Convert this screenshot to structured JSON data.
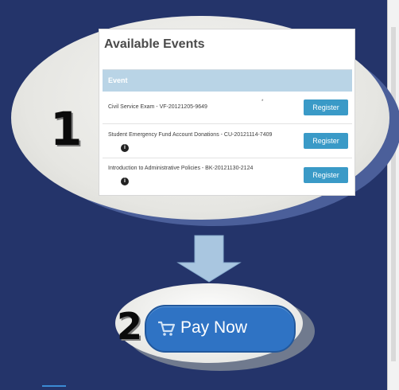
{
  "steps": {
    "first": "1",
    "second": "2"
  },
  "events_panel": {
    "title": "Available Events",
    "column_header": "Event",
    "rows": [
      {
        "name": "Civil Service Exam - VF-20121205-9649",
        "button": "Register",
        "info": false
      },
      {
        "name": "Student Emergency Fund Account Donations - CU-20121114-7409",
        "button": "Register",
        "info": true
      },
      {
        "name": "Introduction to Administrative Policies - BK-20121130-2124",
        "button": "Register",
        "info": true
      }
    ]
  },
  "pay_button": {
    "label": "Pay Now",
    "icon": "cart-icon"
  },
  "colors": {
    "background": "#24346a",
    "register_button": "#3a9ac7",
    "table_header": "#b9d4e6",
    "pay_button": "#2f73c4",
    "arrow": "#a9c6e0"
  }
}
